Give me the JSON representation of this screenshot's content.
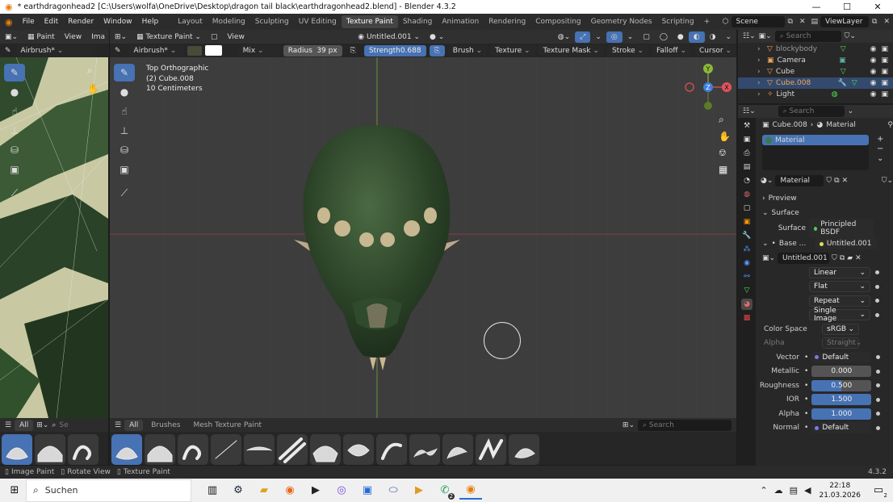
{
  "window": {
    "title": "* earthdragonhead2 [C:\\Users\\wolfa\\OneDrive\\Desktop\\dragon tail black\\earthdragonhead2.blend] - Blender 4.3.2",
    "minimize": "—",
    "maximize": "☐",
    "close": "✕"
  },
  "menu": [
    "File",
    "Edit",
    "Render",
    "Window",
    "Help"
  ],
  "workspaces": [
    "Layout",
    "Modeling",
    "Sculpting",
    "UV Editing",
    "Texture Paint",
    "Shading",
    "Animation",
    "Rendering",
    "Compositing",
    "Geometry Nodes",
    "Scripting",
    "+"
  ],
  "active_workspace": "Texture Paint",
  "scene": {
    "label": "Scene",
    "viewlayer": "ViewLayer"
  },
  "image_editor": {
    "mode": "Paint",
    "view": "View",
    "image": "Ima",
    "brush": "Airbrush*"
  },
  "viewport_header": {
    "mode": "Texture Paint",
    "view": "View",
    "image": "Untitled.001"
  },
  "tool_settings": {
    "brush": "Airbrush*",
    "blend": "Mix",
    "radius_label": "Radius",
    "radius_value": "39 px",
    "strength_label": "Strength",
    "strength_value": "0.688",
    "menus": [
      "Brush",
      "Texture",
      "Texture Mask",
      "Stroke",
      "Falloff",
      "Cursor"
    ]
  },
  "overlay_text": {
    "line1": "Top Orthographic",
    "line2": "(2) Cube.008",
    "line3": "10 Centimeters"
  },
  "gizmo": {
    "x": "X",
    "y": "Y",
    "z": "Z"
  },
  "outliner": {
    "search_placeholder": "Search",
    "items": [
      "blockybody",
      "Camera",
      "Cube",
      "Cube.008",
      "Light"
    ],
    "selected": "Cube.008"
  },
  "properties": {
    "search_placeholder": "Search",
    "breadcrumb_object": "Cube.008",
    "breadcrumb_material": "Material",
    "slot": "Material",
    "material_name": "Material",
    "preview": "Preview",
    "surface_header": "Surface",
    "surface_label": "Surface",
    "surface_value": "Principled BSDF",
    "base_label": "Base ...",
    "base_value": "Untitled.001",
    "image_name": "Untitled.001",
    "interp": "Linear",
    "projection": "Flat",
    "extension": "Repeat",
    "source": "Single Image",
    "color_space_label": "Color Space",
    "color_space_value": "sRGB",
    "alpha_label": "Alpha",
    "alpha_value": "Straight",
    "vector_label": "Vector",
    "vector_value": "Default",
    "metallic_label": "Metallic",
    "metallic_value": "0.000",
    "roughness_label": "Roughness",
    "roughness_value": "0.500",
    "roughness_fraction": 0.5,
    "ior_label": "IOR",
    "ior_value": "1.500",
    "alpha2_label": "Alpha",
    "alpha2_value": "1.000",
    "normal_label": "Normal",
    "normal_value": "Default"
  },
  "asset_shelf": {
    "all": "All",
    "tabs": [
      "All",
      "Brushes",
      "Mesh Texture Paint"
    ],
    "search_placeholder": "Search",
    "search_left": "Se"
  },
  "status": {
    "image_paint": "Image Paint",
    "rotate_view": "Rotate View",
    "texture_paint": "Texture Paint",
    "version": "4.3.2"
  },
  "taskbar": {
    "search": "Suchen",
    "time": "22:18",
    "date": "21.03.2026",
    "notif": "2",
    "whatsapp_badge": "2"
  },
  "colors": {
    "accent": "#4772b3",
    "title_bg": "#ffffff",
    "panel_bg": "#282828",
    "viewport_bg": "#3d3d3d"
  }
}
